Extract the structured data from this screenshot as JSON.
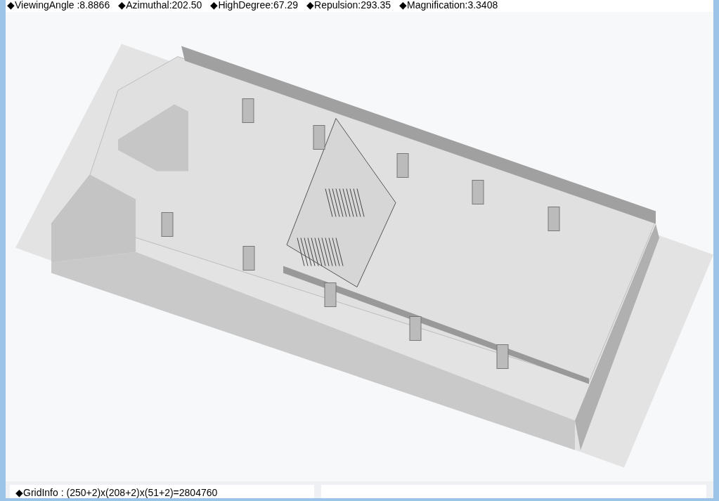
{
  "top_stats": [
    "◆ViewingAngle :8.8866",
    "◆Azimuthal:202.50",
    "◆HighDegree:67.29",
    "◆Repulsion:293.35",
    "◆Magnification:3.3408"
  ],
  "status_bar": {
    "grid_info": "◆GridInfo : (250+2)x(208+2)x(51+2)=2804760"
  }
}
